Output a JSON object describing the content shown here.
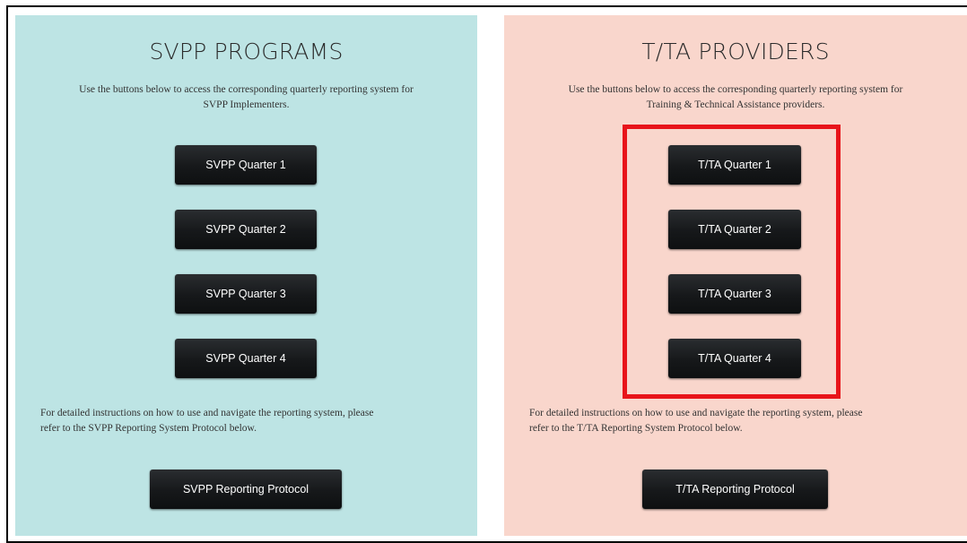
{
  "left_panel": {
    "title": "SVPP PROGRAMS",
    "intro_line1": "Use the buttons below to access the corresponding quarterly reporting system for",
    "intro_line2": "SVPP Implementers.",
    "buttons": [
      "SVPP Quarter 1",
      "SVPP Quarter 2",
      "SVPP Quarter 3",
      "SVPP Quarter 4"
    ],
    "instructions_line1": "For detailed instructions on how to use and navigate the reporting system, please",
    "instructions_line2": "refer to the SVPP Reporting System Protocol below.",
    "protocol_button": "SVPP Reporting Protocol",
    "background_color": "#bde4e4"
  },
  "right_panel": {
    "title": "T/TA PROVIDERS",
    "intro_line1": "Use the buttons below to access the corresponding quarterly reporting system for",
    "intro_line2": "Training & Technical Assistance providers.",
    "buttons": [
      "T/TA Quarter 1",
      "T/TA Quarter 2",
      "T/TA Quarter 3",
      "T/TA Quarter 4"
    ],
    "instructions_line1": "For detailed instructions on how to use and navigate the reporting system, please",
    "instructions_line2": "refer to the T/TA Reporting System Protocol below.",
    "protocol_button": "T/TA Reporting Protocol",
    "background_color": "#f9d6cc"
  },
  "highlight": {
    "color": "#e8141a"
  }
}
